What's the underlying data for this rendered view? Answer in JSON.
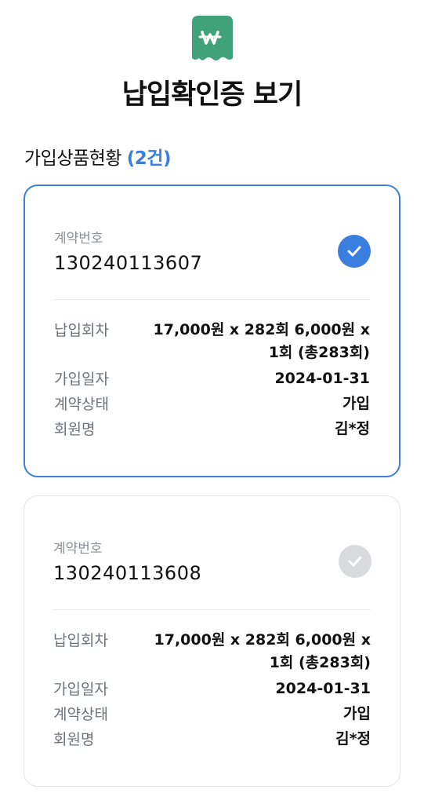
{
  "header": {
    "title": "납입확인증 보기"
  },
  "section": {
    "title": "가입상품현황",
    "count": "(2건)"
  },
  "labels": {
    "contract_no": "계약번호",
    "payment_count": "납입회차",
    "join_date": "가입일자",
    "contract_status": "계약상태",
    "member_name": "회원명"
  },
  "contracts": [
    {
      "number": "130240113607",
      "selected": true,
      "payment": "17,000원 x 282회 6,000원 x 1회 (총283회)",
      "join_date": "2024-01-31",
      "status": "가입",
      "member": "김*정"
    },
    {
      "number": "130240113608",
      "selected": false,
      "payment": "17,000원 x 282회 6,000원 x 1회 (총283회)",
      "join_date": "2024-01-31",
      "status": "가입",
      "member": "김*정"
    }
  ],
  "colors": {
    "accent": "#3a7ee0",
    "brand_green": "#3fa27a",
    "check_off": "#d8dade"
  },
  "icons": {
    "logo": "receipt-won-icon",
    "check": "checkmark-icon"
  }
}
